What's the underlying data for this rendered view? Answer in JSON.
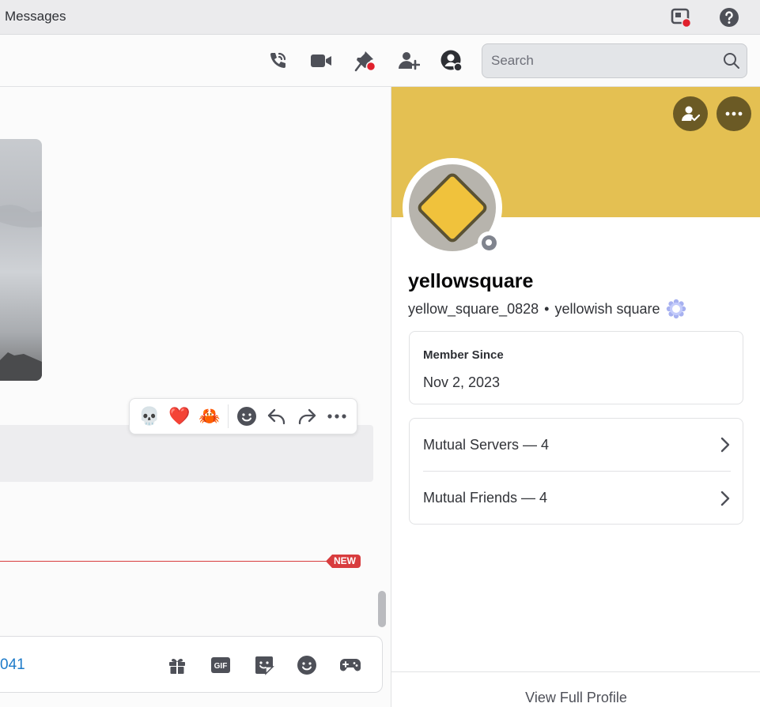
{
  "window": {
    "title": "Messages"
  },
  "header": {
    "search_placeholder": "Search",
    "icons": [
      "phone-call-icon",
      "video-camera-icon",
      "pin-icon",
      "add-friend-icon",
      "user-profile-icon",
      "search-icon"
    ]
  },
  "message_toolbar": {
    "reactions": [
      "💀",
      "❤️",
      "🦀"
    ],
    "actions": [
      "add-reaction-icon",
      "reply-icon",
      "forward-icon",
      "more-icon"
    ]
  },
  "chat": {
    "new_label": "NEW"
  },
  "composer": {
    "partial_text": "041",
    "icons": [
      "gift-icon",
      "gif-icon",
      "sticker-icon",
      "emoji-icon",
      "game-controller-icon"
    ],
    "gif_label": "GIF"
  },
  "profile": {
    "display_name": "yellowsquare",
    "username": "yellow_square_0828",
    "separator": "•",
    "pronouns": "yellowish square",
    "member_since_label": "Member Since",
    "member_since_value": "Nov 2, 2023",
    "mutual_servers": "Mutual Servers — 4",
    "mutual_friends": "Mutual Friends — 4",
    "view_full_profile": "View Full Profile",
    "banner_color": "#e4c052",
    "status": "offline"
  },
  "colors": {
    "accent_red": "#d83c3e",
    "link_blue": "#1e7bc9"
  }
}
